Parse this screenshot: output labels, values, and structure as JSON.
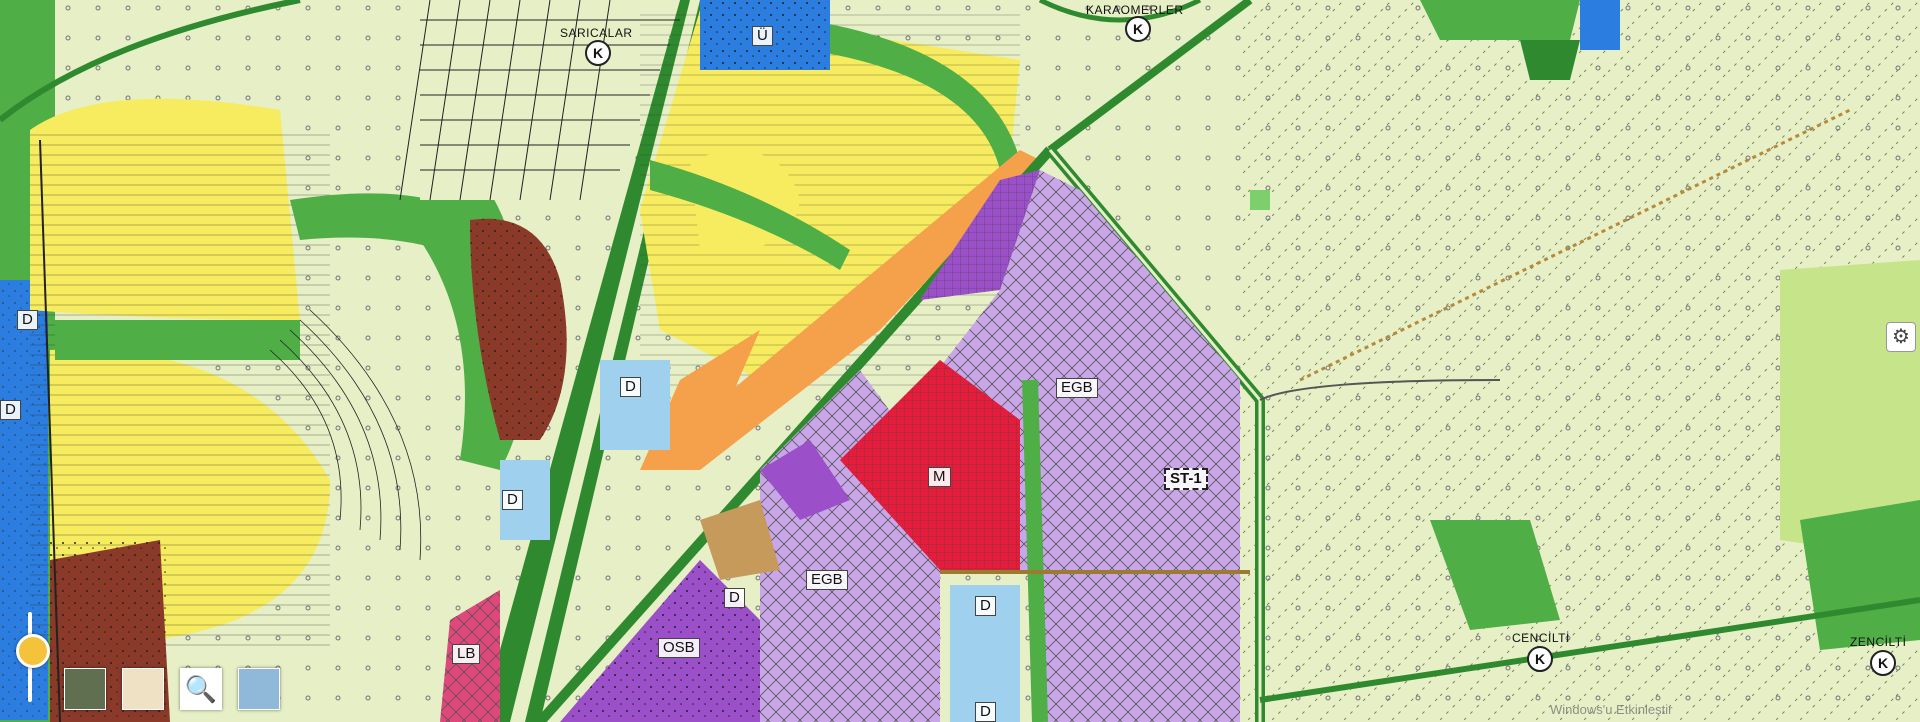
{
  "map": {
    "labels": {
      "karaomerler": "KARAOMERLER",
      "saricalar": "SARICALAR",
      "cencilti_1": "CENCİLTİ",
      "cencilti_2": "ZENCİLTİ",
      "u": "Ü",
      "d1": "D",
      "d2": "D",
      "d3": "D",
      "d4": "D",
      "d5": "D",
      "d6": "D",
      "d7": "D",
      "d8": "D",
      "egb1": "EGB",
      "egb2": "EGB",
      "m": "M",
      "st1": "ST-1",
      "osb": "OSB",
      "lb": "LB",
      "k": "K"
    },
    "watermark": "Windows'u Etkinleştir"
  },
  "controls": {
    "gear_icon": "⚙",
    "search_icon": "🔍"
  },
  "colors": {
    "agri": "#e6efc6",
    "green": "#4fae45",
    "dark_green": "#2f8a2f",
    "yellow": "#f7ec5f",
    "orange": "#f5a04a",
    "purple": "#c9a6e8",
    "dark_purple": "#9b4fc9",
    "red": "#e51c3b",
    "blue": "#2b7de0",
    "brown": "#8b3a2a",
    "light_blue": "#9fd1ef"
  }
}
